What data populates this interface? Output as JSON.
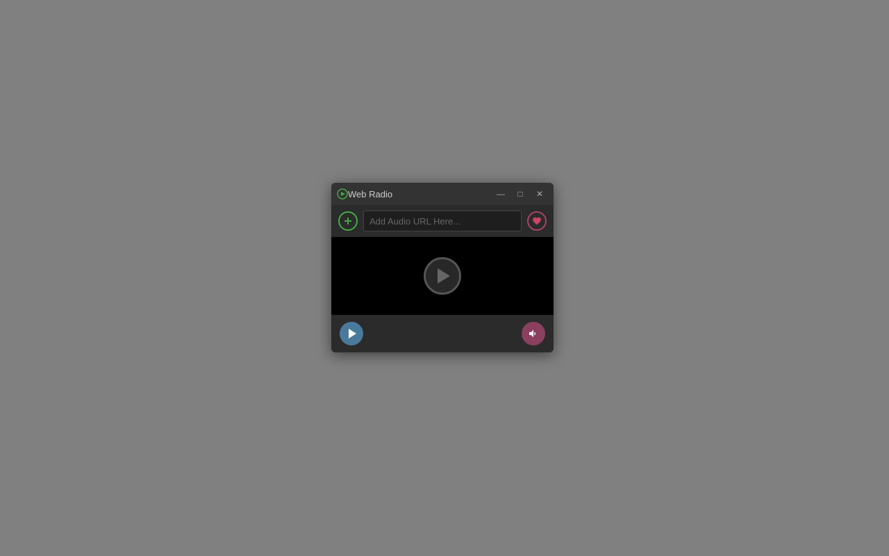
{
  "desktop": {
    "background_color": "#808080"
  },
  "window": {
    "title": "Web Radio",
    "controls": {
      "minimize_label": "—",
      "maximize_label": "□",
      "close_label": "✕"
    }
  },
  "url_bar": {
    "placeholder": "Add Audio URL Here...",
    "add_btn_label": "+",
    "fav_btn_label": "♥"
  },
  "video_area": {
    "play_large_label": "▶"
  },
  "controls": {
    "play_btn_label": "▶",
    "volume_btn_label": "🔊"
  }
}
